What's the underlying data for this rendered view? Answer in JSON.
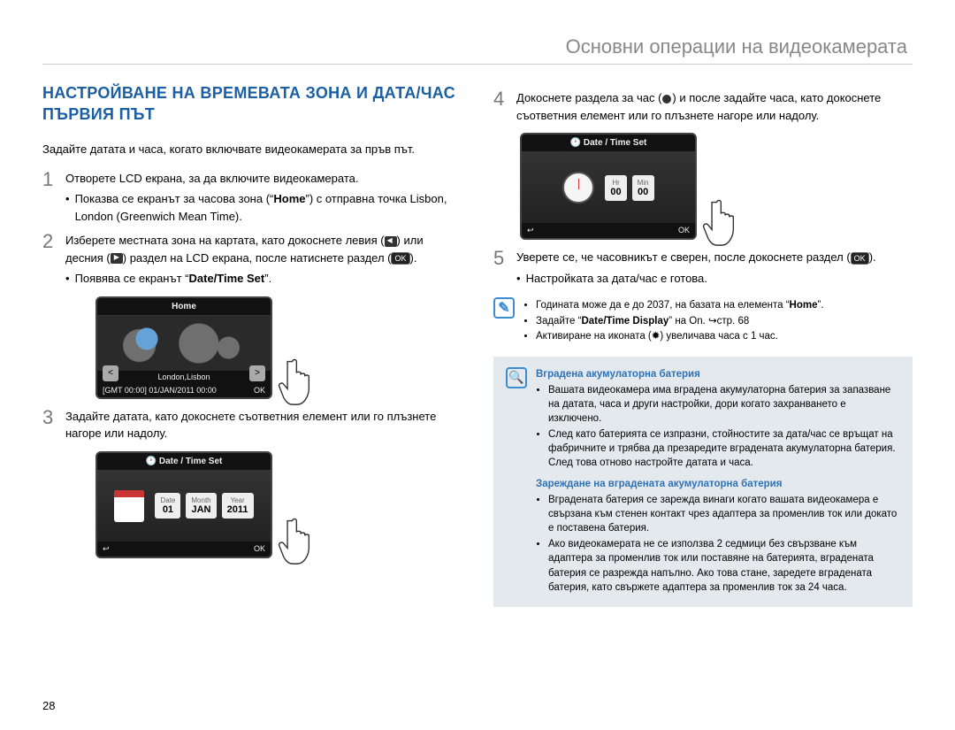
{
  "breadcrumb": "Основни операции на видеокамерата",
  "page_number": "28",
  "section_title": "НАСТРОЙВАНЕ НА ВРЕМЕВАТА ЗОНА И ДАТА/ЧАС ПЪРВИЯ ПЪТ",
  "intro": "Задайте датата и часа, когато включвате видеокамерата за пръв път.",
  "steps": {
    "s1": {
      "num": "1",
      "text": "Отворете LCD екрана, за да включите видеокамерата.",
      "b1_a": "Показва се екранът за часова зона (“",
      "b1_home": "Home",
      "b1_b": "”) с отправна точка Lisbon, London (Greenwich Mean Time)."
    },
    "s2": {
      "num": "2",
      "text_a": "Изберете местната зона на картата, като докоснете левия (",
      "text_b": ") или десния (",
      "text_c": ") раздел на LCD екрана, после натиснете раздел (",
      "text_d": ").",
      "ok": "OK",
      "b1_a": "Появява се екранът “",
      "b1_bold": "Date/Time Set",
      "b1_b": "”."
    },
    "s3": {
      "num": "3",
      "text": "Задайте датата, като докоснете съответния елемент или го плъзнете нагоре или надолу."
    },
    "s4": {
      "num": "4",
      "text_a": "Докоснете раздела за час (",
      "text_b": ") и после задайте часа, като докоснете съответния елемент или го плъзнете нагоре или надолу."
    },
    "s5": {
      "num": "5",
      "text_a": "Уверете се, че часовникът е сверен, после докоснете раздел (",
      "text_b": ").",
      "ok": "OK",
      "b1": "Настройката за дата/час е готова."
    }
  },
  "screens": {
    "home": {
      "title": "Home",
      "caption": "London,Lisbon",
      "foot_left": "[GMT 00:00] 01/JAN/2011 00:00",
      "foot_right": "OK",
      "nav_left": "<",
      "nav_right": ">"
    },
    "date": {
      "title": "Date / Time Set",
      "h_date": "Date",
      "h_month": "Month",
      "h_year": "Year",
      "v_date": "01",
      "v_month": "JAN",
      "v_year": "2011",
      "back": "↩",
      "ok": "OK"
    },
    "time": {
      "title": "Date / Time Set",
      "h_hr": "Hr",
      "h_min": "Min",
      "v_hr": "00",
      "v_min": "00",
      "back": "↩",
      "ok": "OK"
    }
  },
  "notes": {
    "n1": "Годината може да е до 2037, на базата на елемента “",
    "n1_home": "Home",
    "n1_end": "”.",
    "n2_a": "Задайте “",
    "n2_bold": "Date/Time Display",
    "n2_b": "” на On. ",
    "n2_page": "стр. 68",
    "n3_a": "Активиране на иконата (",
    "n3_b": ") увеличава часа с 1 час."
  },
  "infobox": {
    "h1": "Вградена акумулаторна батерия",
    "b1": "Вашата видеокамера има вградена акумулаторна батерия за запазване на датата, часа и други настройки, дори когато захранването е изключено.",
    "b2": "След като батерията се изпразни, стойностите за дата/час се връщат на фабричните и трябва да презаредите вградената акумулаторна батерия. След това отново настройте датата и часа.",
    "h2": "Зареждане на вградената акумулаторна батерия",
    "b3": "Вградената батерия се зарежда винаги когато вашата видеокамера е свързана към стенен контакт чрез адаптера за променлив ток или докато е поставена батерия.",
    "b4": "Ако видеокамерата не се използва 2 седмици без свързване към адаптера за променлив ток или поставяне на батерията, вградената батерия се разрежда напълно. Ако това стане, заредете вградената батерия, като свържете адаптера за променлив ток за 24 часа."
  }
}
